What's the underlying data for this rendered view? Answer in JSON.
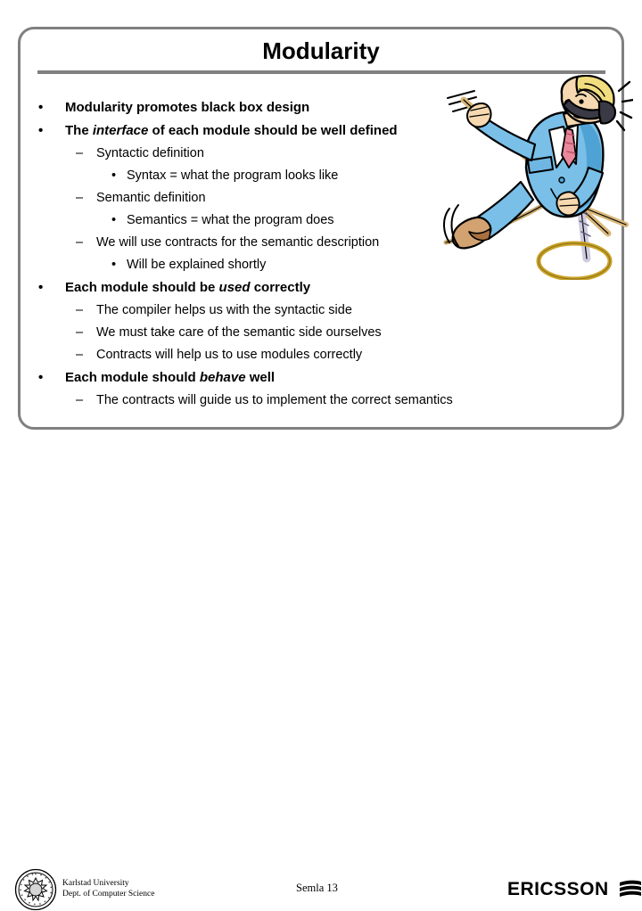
{
  "slide": {
    "title": "Modularity",
    "background_color": "#ffffff",
    "frame_border_color": "#808080",
    "text_color": "#000000"
  },
  "body": {
    "lines": [
      {
        "level": 1,
        "marker": "•",
        "text": "Modularity promotes black box design"
      },
      {
        "level": 1,
        "marker": "•",
        "text_pre": "The ",
        "text_em": "interface",
        "text_post": " of each module should be well defined"
      },
      {
        "level": 2,
        "marker": "–",
        "text": "Syntactic definition"
      },
      {
        "level": 3,
        "marker": "•",
        "text": "Syntax = what the program looks like"
      },
      {
        "level": 2,
        "marker": "–",
        "text": "Semantic definition"
      },
      {
        "level": 3,
        "marker": "•",
        "text": "Semantics = what the program does"
      },
      {
        "level": 2,
        "marker": "–",
        "text": "We will use contracts for the semantic description"
      },
      {
        "level": 3,
        "marker": "•",
        "text": "Will be explained shortly"
      },
      {
        "level": 1,
        "marker": "•",
        "text_pre": "Each module should be ",
        "text_em": "used",
        "text_post": " correctly"
      },
      {
        "level": 2,
        "marker": "–",
        "text": "The compiler helps us with the syntactic side"
      },
      {
        "level": 2,
        "marker": "–",
        "text": "We must take care of the semantic side ourselves"
      },
      {
        "level": 2,
        "marker": "–",
        "text": "Contracts will help us to use modules correctly"
      },
      {
        "level": 1,
        "marker": "•",
        "text_pre": "Each module should ",
        "text_em": "behave",
        "text_post": " well"
      },
      {
        "level": 2,
        "marker": "–",
        "text": "The contracts will guide us to implement the correct semantics"
      }
    ]
  },
  "illustration": {
    "name": "businessman-tightrope-walker-clipart",
    "description": "Cartoon businessman in a light blue suit balancing on a tightrope with a long balance pole while talking on a telephone handset; a gold ring hangs below",
    "colors": {
      "suit": "#79BFE8",
      "suit_shadow": "#4FA3D4",
      "skin": "#F6D9B0",
      "hair": "#F2DD7E",
      "tie": "#E8889A",
      "pole": "#D9B77A",
      "rope": "#C8A96A",
      "shoe": "#B07A4E",
      "ring": "#C9A227",
      "outline": "#000000"
    }
  },
  "footer": {
    "university_line1": "Karlstad University",
    "university_line2": "Dept. of Computer Science",
    "seal_icon": "karlstad-university-seal",
    "center_label": "Semla 13",
    "brand": "ERICSSON",
    "brand_mark": "ericsson-three-stripes-logo"
  }
}
